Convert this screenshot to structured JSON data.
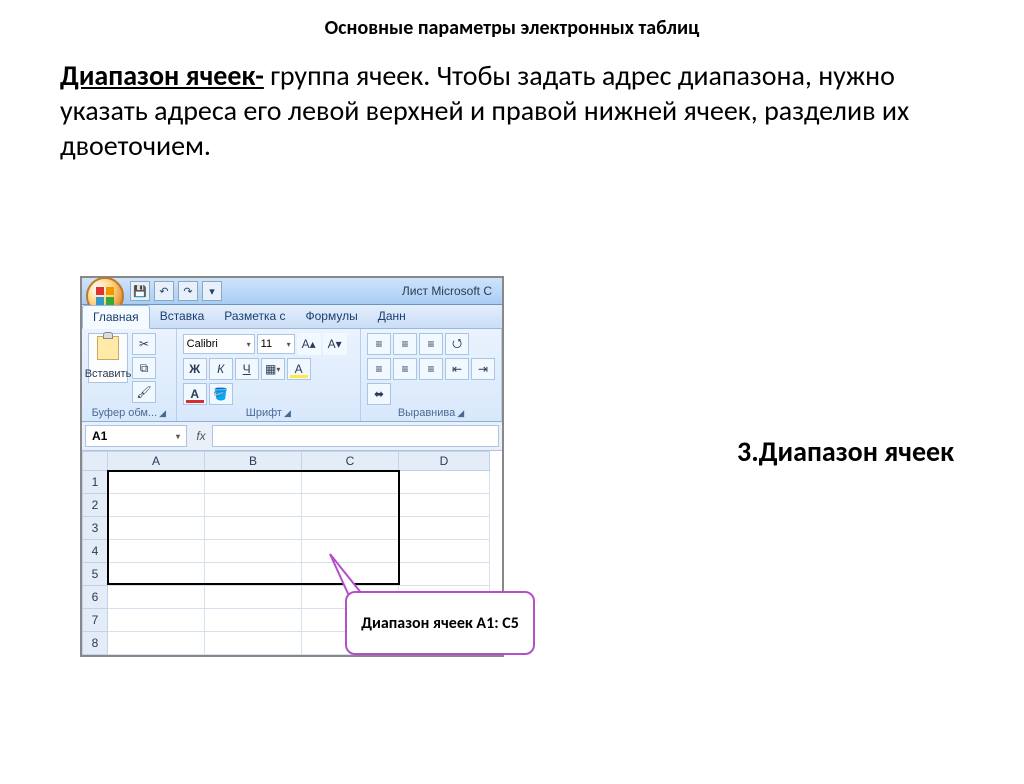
{
  "slide": {
    "title": "Основные параметры электронных таблиц",
    "term": "Диапазон ячеек-",
    "definition": " группа ячеек. Чтобы задать адрес диапазона, нужно указать адреса его левой верхней и правой нижней ячеек,  разделив их двоеточием.",
    "section_label": "3.Диапазон ячеек",
    "callout": "Диапазон ячеек А1: С5"
  },
  "excel": {
    "window_title": "Лист Microsoft С",
    "qat": {
      "save": "💾",
      "undo": "↶",
      "redo": "↷",
      "more": "▾"
    },
    "tabs": [
      "Главная",
      "Вставка",
      "Разметка с",
      "Формулы",
      "Данн"
    ],
    "active_tab": 0,
    "ribbon": {
      "clipboard": {
        "paste": "Вставить",
        "label": "Буфер обм..."
      },
      "font": {
        "name": "Calibri",
        "size": "11",
        "bold": "Ж",
        "italic": "К",
        "underline": "Ч",
        "label": "Шрифт"
      },
      "align": {
        "label": "Выравнива"
      }
    },
    "namebox": "A1",
    "fx": "fx",
    "columns": [
      "A",
      "B",
      "C",
      "D"
    ],
    "rows": [
      "1",
      "2",
      "3",
      "4",
      "5",
      "6",
      "7",
      "8"
    ]
  }
}
